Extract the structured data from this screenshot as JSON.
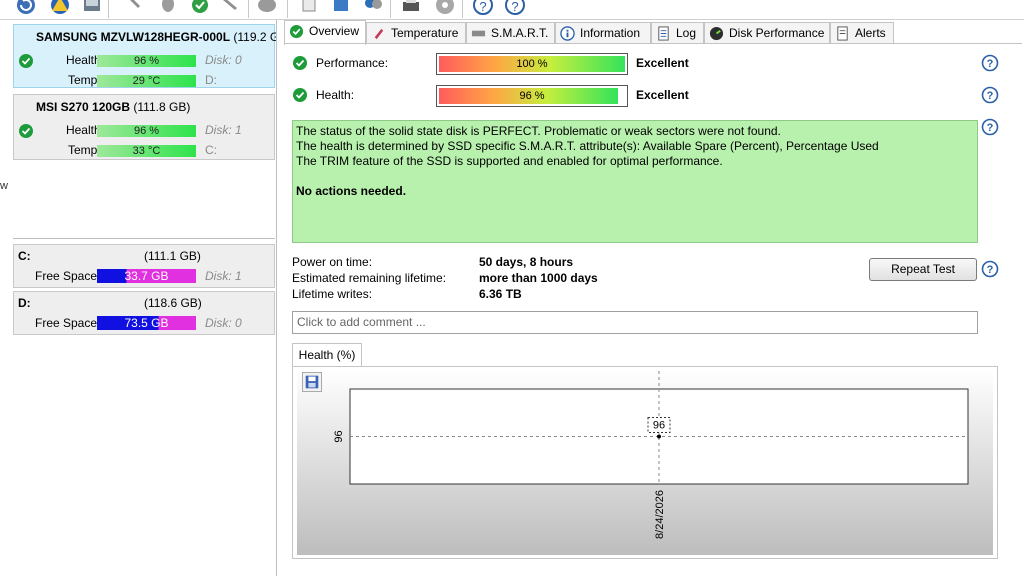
{
  "toolbar": {
    "icons": [
      "refresh-icon",
      "warning-icon",
      "disk-icon",
      "tools-icon",
      "mouse-icon",
      "check-icon",
      "tools-icon-2",
      "cloud-icon",
      "document-icon",
      "export-icon",
      "people-icon",
      "printer-icon",
      "disc-icon",
      "help-icon",
      "info-icon"
    ]
  },
  "left_edge_glyph": "w",
  "disks": [
    {
      "model": "SAMSUNG MZVLW128HEGR-000L",
      "capacity": "(119.2 G",
      "health_label": "Health:",
      "health": "96 %",
      "temp_label": "Temp.:",
      "temp": "29 °C",
      "disk_label": "Disk: 0",
      "drive": "D:"
    },
    {
      "model": "MSI S270 120GB",
      "capacity": "(111.8 GB)",
      "health_label": "Health:",
      "health": "96 %",
      "temp_label": "Temp.:",
      "temp": "33 °C",
      "disk_label": "Disk: 1",
      "drive": "C:"
    }
  ],
  "partitions": [
    {
      "letter": "C:",
      "size": "(111.1 GB)",
      "free_label": "Free Space",
      "free": "33.7 GB",
      "free_fraction": 0.303,
      "disk": "Disk: 1"
    },
    {
      "letter": "D:",
      "size": "(118.6 GB)",
      "free_label": "Free Space",
      "free": "73.5 GB",
      "free_fraction": 0.62,
      "disk": "Disk: 0"
    }
  ],
  "tabs": [
    {
      "label": "Overview",
      "icon": "check-icon"
    },
    {
      "label": "Temperature",
      "icon": "thermometer-icon"
    },
    {
      "label": "S.M.A.R.T.",
      "icon": "drive-icon"
    },
    {
      "label": "Information",
      "icon": "info-icon"
    },
    {
      "label": "Log",
      "icon": "log-icon"
    },
    {
      "label": "Disk Performance",
      "icon": "gauge-icon"
    },
    {
      "label": "Alerts",
      "icon": "alerts-icon"
    }
  ],
  "overview": {
    "performance_label": "Performance:",
    "performance_value": "100 %",
    "performance_fraction": 1.0,
    "performance_rating": "Excellent",
    "health_label": "Health:",
    "health_value": "96 %",
    "health_fraction": 0.96,
    "health_rating": "Excellent",
    "status_lines": [
      "The status of the solid state disk is PERFECT. Problematic or weak sectors were not found.",
      "The health is determined by SSD specific S.M.A.R.T. attribute(s):  Available Spare (Percent), Percentage Used",
      "The TRIM feature of the SSD is supported and enabled for optimal performance."
    ],
    "status_action": "No actions needed.",
    "power_on_label": "Power on time:",
    "power_on_value": "50 days, 8 hours",
    "lifetime_label": "Estimated remaining lifetime:",
    "lifetime_value": "more than 1000 days",
    "writes_label": "Lifetime writes:",
    "writes_value": "6.36 TB",
    "repeat_button": "Repeat Test",
    "comment_placeholder": "Click to add comment ..."
  },
  "chart_tab": "Health (%)",
  "chart_data": {
    "type": "line",
    "x": [
      "8/24/2026"
    ],
    "series": [
      {
        "values": [
          96
        ]
      }
    ],
    "y_tick_labels": [
      "96"
    ],
    "point_labels": [
      "96"
    ],
    "grid": true
  },
  "colors": {
    "selected_card": "#d9f1fb",
    "status_green": "#b8f0ae",
    "free_space_blue": "#1010e0",
    "free_space_magenta": "#e030e0"
  }
}
